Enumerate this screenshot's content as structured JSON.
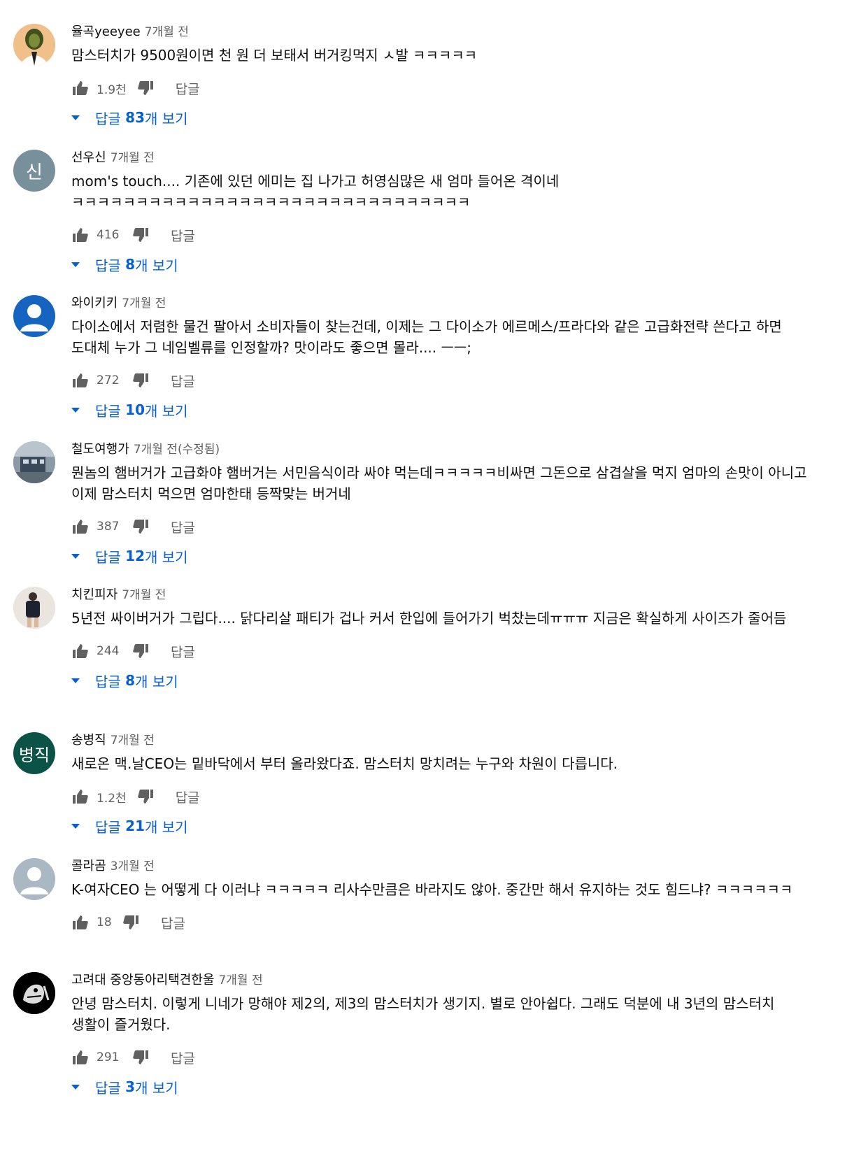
{
  "comments": [
    {
      "author": "율곡yeeyee",
      "time": "7개월 전",
      "text": "맘스터치가 9500원이면 천 원 더 보태서 버거킹먹지 ㅅ발 ㅋㅋㅋㅋㅋ",
      "likes": "1.9천",
      "reply_label": "답글",
      "replies_prefix": "답글 ",
      "replies_count": "83",
      "replies_suffix": "개 보기",
      "avatar_letter": ""
    },
    {
      "author": "선우신",
      "time": "7개월 전",
      "text": "mom's touch.... 기존에 있던 에미는 집 나가고 허영심많은 새 엄마 들어온 격이네 ㅋㅋㅋㅋㅋㅋㅋㅋㅋㅋㅋㅋㅋㅋㅋㅋㅋㅋㅋㅋㅋㅋㅋㅋㅋㅋㅋㅋㅋㅋㅋ",
      "likes": "416",
      "reply_label": "답글",
      "replies_prefix": "답글 ",
      "replies_count": "8",
      "replies_suffix": "개 보기",
      "avatar_letter": "신"
    },
    {
      "author": "와이키키",
      "time": "7개월 전",
      "text": "다이소에서 저렴한 물건 팔아서 소비자들이 찾는건데, 이제는 그 다이소가 에르메스/프라다와 같은 고급화전략 쓴다고 하면 도대체 누가 그 네임벨류를 인정할까? 맛이라도 좋으면 몰라.... ㅡㅡ;",
      "likes": "272",
      "reply_label": "답글",
      "replies_prefix": "답글 ",
      "replies_count": "10",
      "replies_suffix": "개 보기",
      "avatar_letter": ""
    },
    {
      "author": "철도여행가",
      "time": "7개월 전(수정됨)",
      "text": "뭔놈의 햄버거가 고급화야 햄버거는 서민음식이라 싸야 먹는데ㅋㅋㅋㅋㅋ비싸면 그돈으로 삼겹살을  먹지 엄마의 손맛이 아니고 이제 맘스터치 먹으면 엄마한태 등짝맞는 버거네",
      "likes": "387",
      "reply_label": "답글",
      "replies_prefix": "답글 ",
      "replies_count": "12",
      "replies_suffix": "개 보기",
      "avatar_letter": ""
    },
    {
      "author": "치킨피자",
      "time": "7개월 전",
      "text": "5년전 싸이버거가 그립다.... 닭다리살 패티가 겁나 커서 한입에 들어가기 벅찼는데ㅠㅠㅠ 지금은 확실하게 사이즈가 줄어듬",
      "likes": "244",
      "reply_label": "답글",
      "replies_prefix": "답글 ",
      "replies_count": "8",
      "replies_suffix": "개 보기",
      "avatar_letter": ""
    },
    {
      "author": "송병직",
      "time": "7개월 전",
      "text": "새로온 맥.날CEO는 밑바닥에서 부터 올라왔다죠. 맘스터치 망치려는 누구와 차원이 다릅니다.",
      "likes": "1.2천",
      "reply_label": "답글",
      "replies_prefix": "답글 ",
      "replies_count": "21",
      "replies_suffix": "개 보기",
      "avatar_letter": "병직"
    },
    {
      "author": "콜라곰",
      "time": "3개월 전",
      "text": "K-여자CEO 는 어떻게 다 이러냐 ㅋㅋㅋㅋㅋ 리사수만큼은 바라지도 않아. 중간만 해서 유지하는 것도 힘드냐? ㅋㅋㅋㅋㅋㅋ",
      "likes": "18",
      "reply_label": "답글",
      "replies_prefix": "",
      "replies_count": "",
      "replies_suffix": "",
      "avatar_letter": ""
    },
    {
      "author": "고려대 중앙동아리택견한울",
      "time": "7개월 전",
      "text": "안녕 맘스터치. 이렇게 니네가 망해야 제2의, 제3의 맘스터치가 생기지. 별로 안아쉽다. 그래도 덕분에 내 3년의 맘스터치 생활이 즐거웠다.",
      "likes": "291",
      "reply_label": "답글",
      "replies_prefix": "답글 ",
      "replies_count": "3",
      "replies_suffix": "개 보기",
      "avatar_letter": ""
    }
  ],
  "colors": {
    "link": "#065fd4",
    "secondary": "#606060",
    "avatar_grey": "#78909c",
    "avatar_green": "#0b5346",
    "avatar_blue": "#1565c0"
  }
}
